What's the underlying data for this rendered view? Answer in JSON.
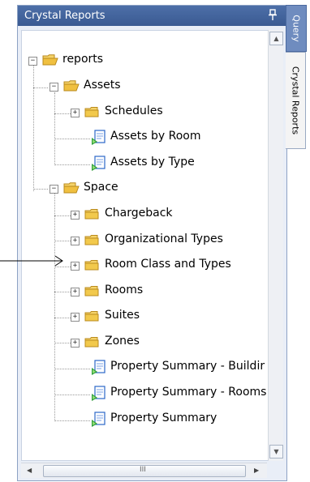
{
  "window": {
    "title": "Crystal Reports"
  },
  "side_tabs": {
    "query": "Query",
    "crystal_reports": "Crystal Reports"
  },
  "tree": {
    "root": "reports",
    "assets": "Assets",
    "schedules": "Schedules",
    "assets_by_room": "Assets by Room",
    "assets_by_type": "Assets by Type",
    "space": "Space",
    "chargeback": "Chargeback",
    "organizational_types": "Organizational Types",
    "room_class_and_types": "Room Class and Types",
    "rooms": "Rooms",
    "suites": "Suites",
    "zones": "Zones",
    "property_summary_building": "Property Summary - Buildir",
    "property_summary_rooms": "Property Summary - Rooms",
    "property_summary": "Property Summary"
  },
  "scrollbar": {
    "grip": "III"
  },
  "icons": {
    "folder": "folder-icon",
    "open_folder": "open-folder-icon",
    "report": "report-icon",
    "pin": "pin-icon"
  },
  "colors": {
    "title_bar": "#3f5f96",
    "folder": "#f2c94c",
    "report_green": "#2e9e3a",
    "report_blue": "#2c67c9"
  }
}
